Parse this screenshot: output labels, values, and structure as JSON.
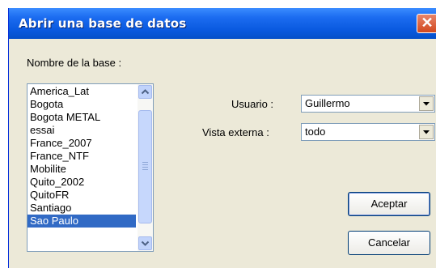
{
  "dialog": {
    "title": "Abrir una base de datos",
    "close_symbol": "✕"
  },
  "database": {
    "label": "Nombre de la base :",
    "items": [
      "America_Lat",
      "Bogota",
      "Bogota METAL",
      "essai",
      "France_2007",
      "France_NTF",
      "Mobilite",
      "Quito_2002",
      "QuitoFR",
      "Santiago",
      "Sao Paulo"
    ],
    "selected": "Sao Paulo"
  },
  "user": {
    "label": "Usuario :",
    "value": "Guillermo"
  },
  "external_view": {
    "label": "Vista externa :",
    "value": "todo"
  },
  "buttons": {
    "accept": "Aceptar",
    "cancel": "Cancelar"
  },
  "colors": {
    "titlebar": "#0A5AE0",
    "selection": "#316AC5",
    "dialog_bg": "#ECE9D8",
    "close_button": "#D2481E"
  }
}
